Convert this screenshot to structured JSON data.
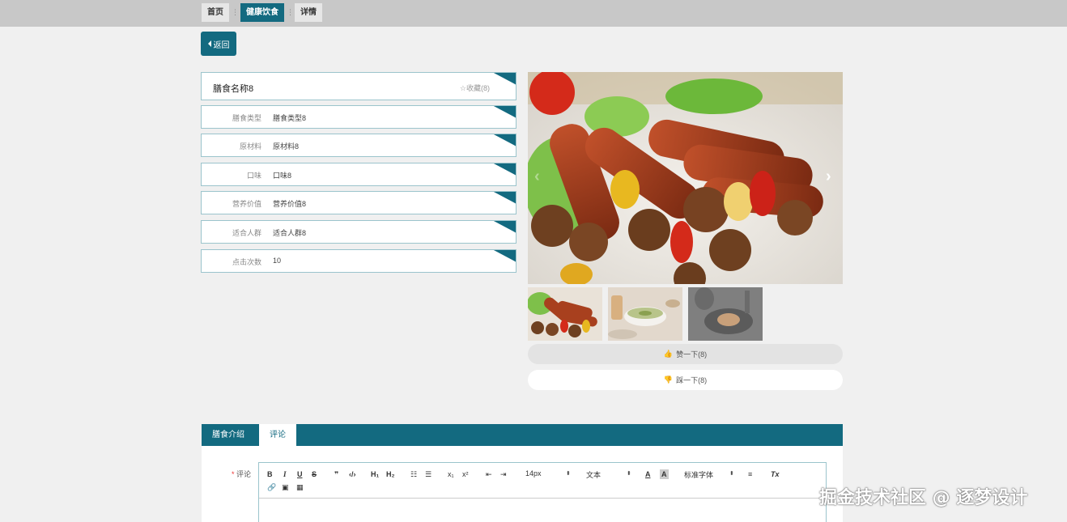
{
  "breadcrumb": {
    "home": "首页",
    "category": "健康饮食",
    "current": "详情",
    "separator": "⋮"
  },
  "back_label": "返回",
  "detail": {
    "title": "膳食名称8",
    "favorite_label": "收藏(8)",
    "rows": [
      {
        "label": "膳食类型",
        "value": "膳食类型8"
      },
      {
        "label": "原材料",
        "value": "原材料8"
      },
      {
        "label": "口味",
        "value": "口味8"
      },
      {
        "label": "营养价值",
        "value": "营养价值8"
      },
      {
        "label": "适合人群",
        "value": "适合人群8"
      },
      {
        "label": "点击次数",
        "value": "10"
      }
    ]
  },
  "gallery": {
    "prev_icon": "‹",
    "next_icon": "›",
    "thumbnail_count": 3
  },
  "vote": {
    "like_label": "赞一下(8)",
    "dislike_label": "踩一下(8)"
  },
  "tabs": [
    {
      "label": "膳食介绍"
    },
    {
      "label": "评论"
    }
  ],
  "comment": {
    "required_mark": "*",
    "label": "评论",
    "toolbar": {
      "bold": "B",
      "italic": "I",
      "underline": "U",
      "strike": "S",
      "quote": "❞",
      "code": "‹/›",
      "h1": "H₁",
      "h2": "H₂",
      "ordered_list": "☷",
      "bullet_list": "☰",
      "subscript": "x₁",
      "superscript": "x²",
      "indent_out": "⇤",
      "indent_in": "⇥",
      "size": "14px",
      "header": "文本",
      "font": "标准字体",
      "color": "A",
      "background": "A",
      "align": "≡",
      "clean": "Tx",
      "link": "🔗",
      "image": "▣",
      "video": "▦"
    }
  },
  "watermark": "掘金技术社区 @ 逐梦设计",
  "colors": {
    "primary": "#136a80",
    "border": "#9bc4cc",
    "topbar": "#c8c8c8",
    "page_bg": "#f0f0f0"
  }
}
